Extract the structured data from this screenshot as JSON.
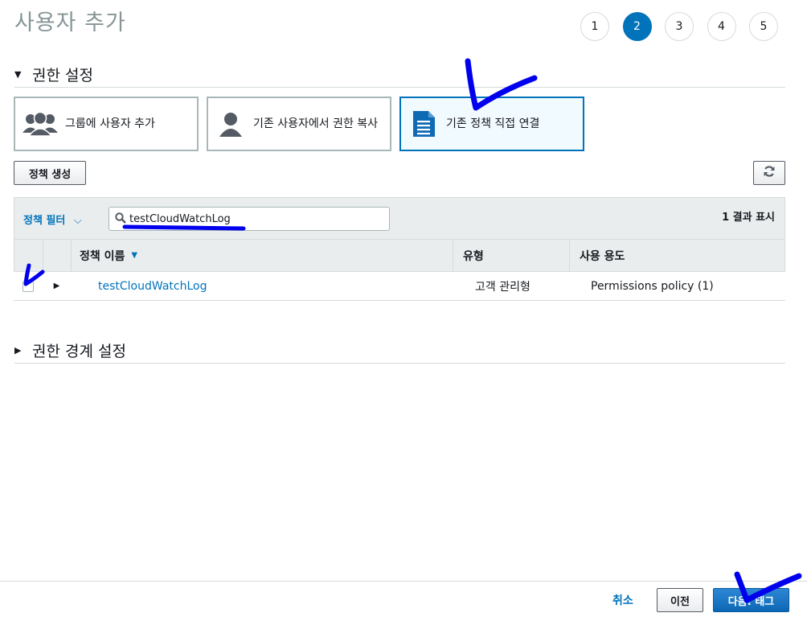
{
  "page": {
    "title": "사용자 추가"
  },
  "steps": [
    "1",
    "2",
    "3",
    "4",
    "5"
  ],
  "active_step": "2",
  "permissions_section": {
    "title": "권한 설정",
    "options": [
      {
        "label": "그룹에 사용자 추가",
        "icon": "users-group-icon",
        "selected": false
      },
      {
        "label": "기존 사용자에서 권한 복사",
        "icon": "user-icon",
        "selected": false
      },
      {
        "label": "기존 정책 직접 연결",
        "icon": "document-icon",
        "selected": true
      }
    ]
  },
  "toolbar": {
    "create_policy_label": "정책 생성",
    "refresh_icon": "refresh-icon"
  },
  "filter": {
    "label": "정책 필터",
    "search_value": "testCloudWatchLog",
    "result_count": "1 결과 표시"
  },
  "table": {
    "columns": [
      "정책 이름",
      "유형",
      "사용 용도"
    ],
    "rows": [
      {
        "name": "testCloudWatchLog",
        "type": "고객 관리형",
        "usage": "Permissions policy (1)",
        "checked": false
      }
    ]
  },
  "boundary_section": {
    "title": "권한 경계 설정"
  },
  "footer": {
    "cancel_label": "취소",
    "prev_label": "이전",
    "next_label": "다음: 태그"
  },
  "colors": {
    "accent": "#0073bb",
    "annotation": "#0000ff",
    "muted": "#879596"
  }
}
